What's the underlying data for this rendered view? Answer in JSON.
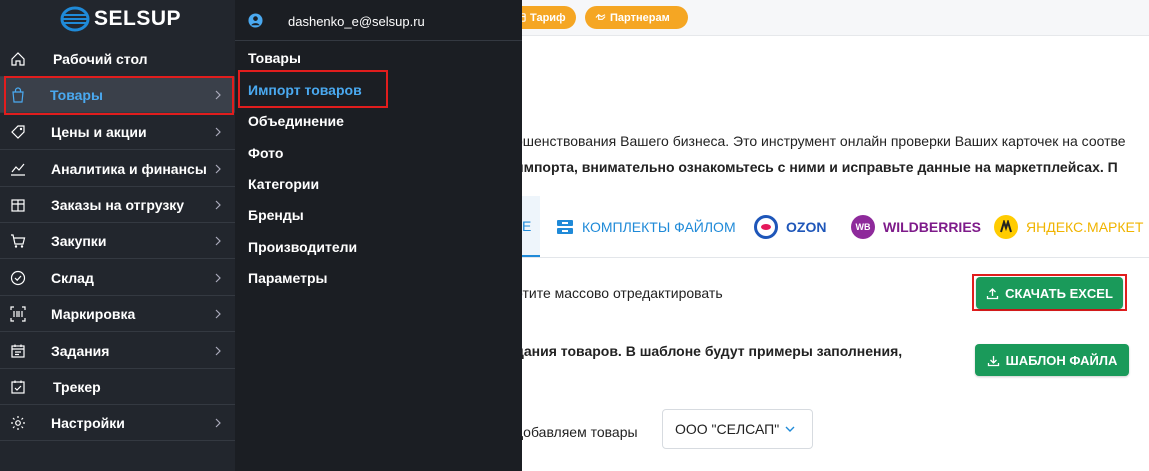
{
  "topbar": {
    "tariff_label": "Тариф",
    "partners_label": "Партнерам"
  },
  "main": {
    "description_line1": "ршенствования Вашего бизнеса. Это инструмент онлайн проверки Ваших карточек на соотве",
    "description_line2": "импорта, внимательно ознакомьтесь с ними и исправьте данные на маркетплейсах.  П",
    "tabs": {
      "active_label": "Е",
      "kits_label": "КОМПЛЕКТЫ ФАЙЛОМ",
      "ozon_label": "OZON",
      "wb_label": "WILDBERRIES",
      "wb_logo_text": "WB",
      "ym_label": "ЯНДЕКС.МАРКЕТ"
    },
    "row1_text": "отите массово отредактировать",
    "download_excel_label": "СКАЧАТЬ EXCEL",
    "row2_text": "дания товаров. В шаблоне будут примеры заполнения,",
    "template_file_label": "ШАБЛОН ФАЙЛА",
    "row3_text": "добавляем товары",
    "org_select_value": "ООО \"СЕЛСАП\""
  },
  "sidebar": {
    "brand": "SELSUP",
    "items": [
      {
        "label": "Рабочий стол",
        "icon": "home-icon"
      },
      {
        "label": "Товары",
        "icon": "bag-icon"
      },
      {
        "label": "Цены и акции",
        "icon": "tag-icon"
      },
      {
        "label": "Аналитика и финансы",
        "icon": "chart-icon"
      },
      {
        "label": "Заказы на отгрузку",
        "icon": "box-icon"
      },
      {
        "label": "Закупки",
        "icon": "cart-icon"
      },
      {
        "label": "Склад",
        "icon": "check-circle-icon"
      },
      {
        "label": "Маркировка",
        "icon": "barcode-icon"
      },
      {
        "label": "Задания",
        "icon": "calendar-icon"
      },
      {
        "label": "Трекер",
        "icon": "calendar-check-icon"
      },
      {
        "label": "Настройки",
        "icon": "gear-icon"
      }
    ]
  },
  "submenu": {
    "user_email": "dashenko_e@selsup.ru",
    "items": [
      "Товары",
      "Импорт товаров",
      "Объединение",
      "Фото",
      "Категории",
      "Бренды",
      "Производители",
      "Параметры"
    ]
  },
  "colors": {
    "sidebar_bg": "#22262d",
    "submenu_bg": "#1b1e23",
    "accent_blue": "#4aa9f0",
    "highlight_red": "#e11d1d",
    "button_green": "#1a9a5a",
    "pill_orange": "#f5a623"
  }
}
